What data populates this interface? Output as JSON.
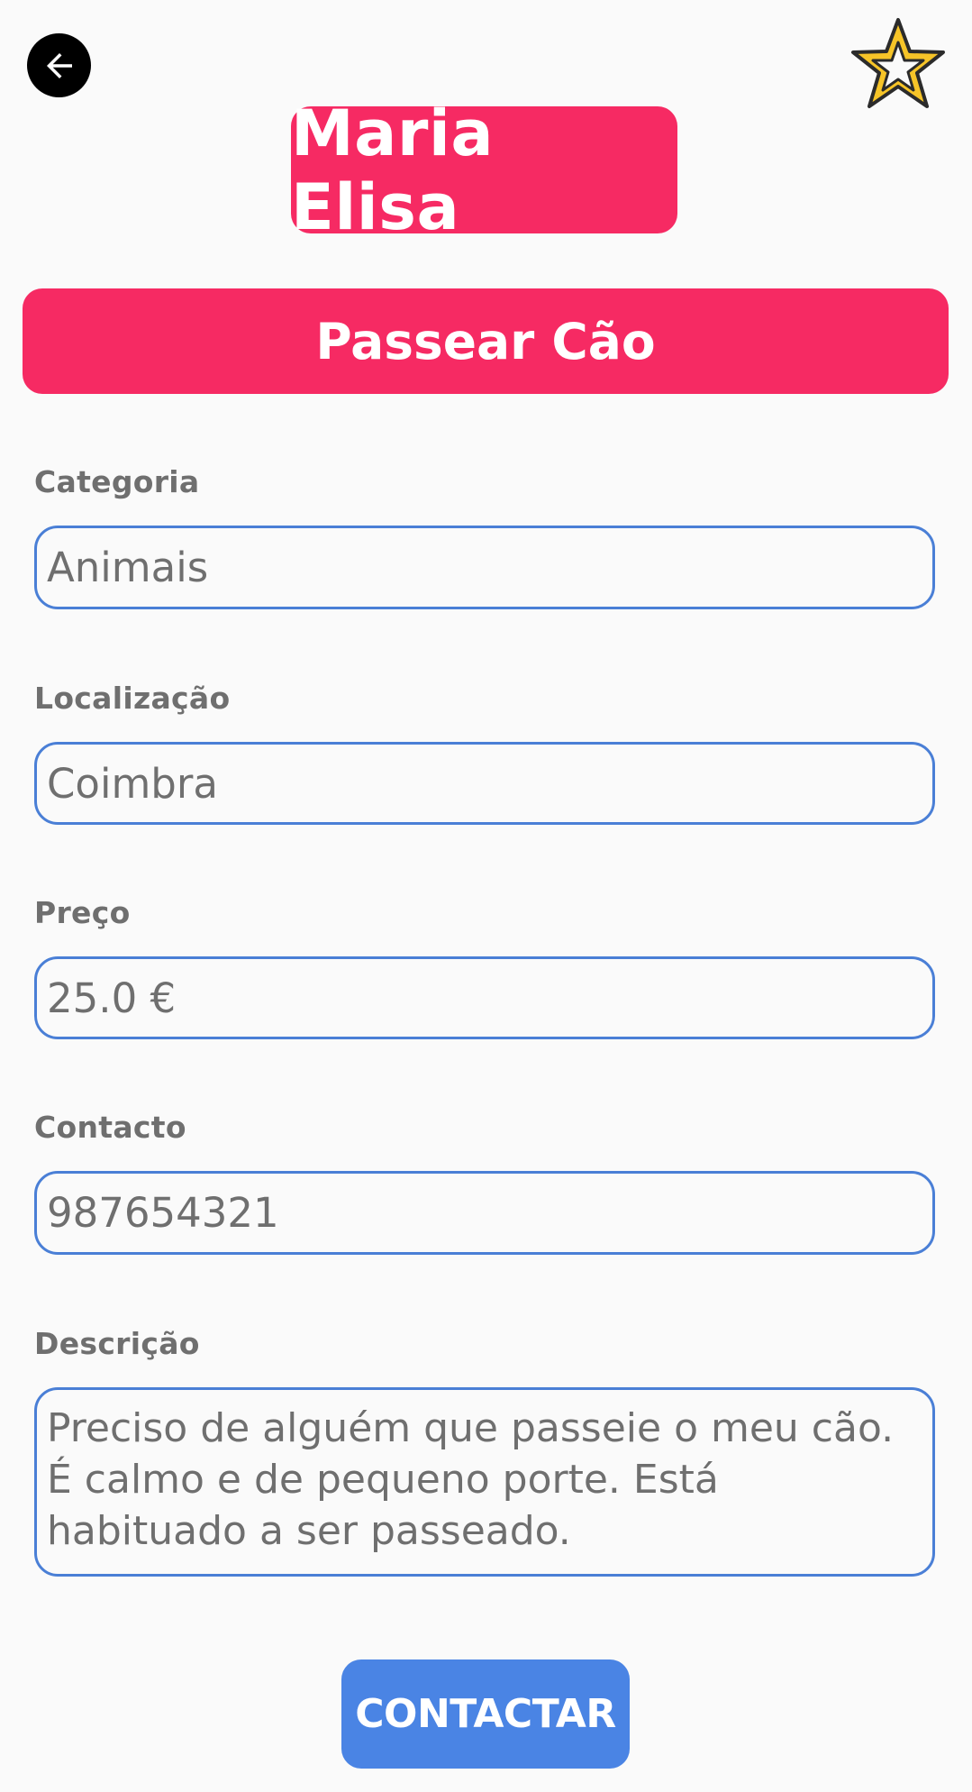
{
  "header": {
    "back_icon": "arrow-left-icon",
    "favorite_icon": "star-outline-icon",
    "name": "Maria Elisa"
  },
  "listing": {
    "title": "Passear Cão"
  },
  "fields": {
    "category": {
      "label": "Categoria",
      "value": "Animais"
    },
    "location": {
      "label": "Localização",
      "value": "Coimbra"
    },
    "price": {
      "label": "Preço",
      "value": "25.0 €"
    },
    "contact": {
      "label": "Contacto",
      "value": "987654321"
    },
    "description": {
      "label": "Descrição",
      "value": "Preciso de alguém que passeie o meu cão. É calmo e de pequeno porte. Está habituado a ser passeado."
    }
  },
  "actions": {
    "contact_label": "CONTACTAR"
  },
  "colors": {
    "accent_pink": "#f62a63",
    "accent_blue": "#4a84e4",
    "field_border": "#4a7fd6",
    "star_fill": "#f6c428",
    "text_gray": "#6f6f6f",
    "background": "#fafafa"
  }
}
